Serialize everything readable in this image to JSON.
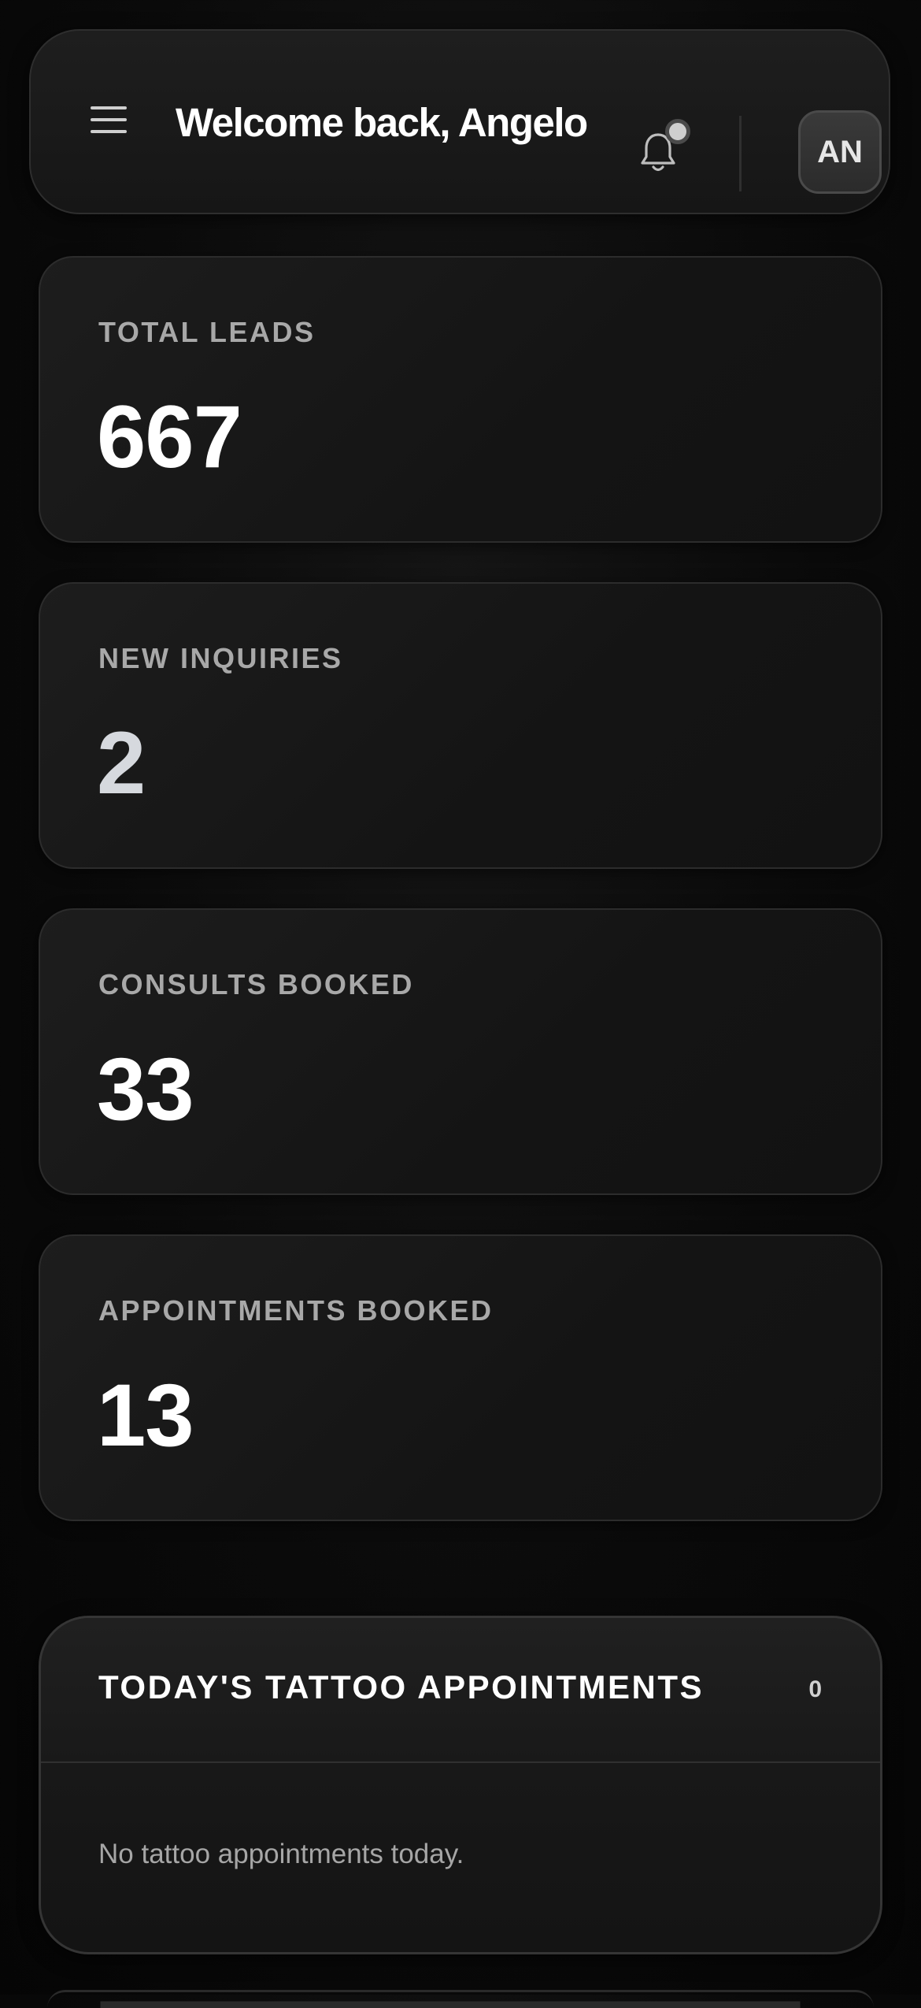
{
  "header": {
    "title": "Welcome back, Angelo",
    "avatar_initials": "AN"
  },
  "stats": [
    {
      "label": "TOTAL LEADS",
      "value": "667"
    },
    {
      "label": "NEW INQUIRIES",
      "value": "2"
    },
    {
      "label": "CONSULTS BOOKED",
      "value": "33"
    },
    {
      "label": "APPOINTMENTS BOOKED",
      "value": "13"
    }
  ],
  "appointments": {
    "title": "TODAY'S TATTOO APPOINTMENTS",
    "count": "0",
    "empty_message": "No tattoo appointments today."
  },
  "icons": {
    "menu": "hamburger-menu-icon",
    "notifications": "bell-icon"
  },
  "colors": {
    "background": "#0a0a0a",
    "card": "#171717",
    "label": "#a8a8a8",
    "value": "#ffffff",
    "value_muted": "#d6d9de"
  }
}
